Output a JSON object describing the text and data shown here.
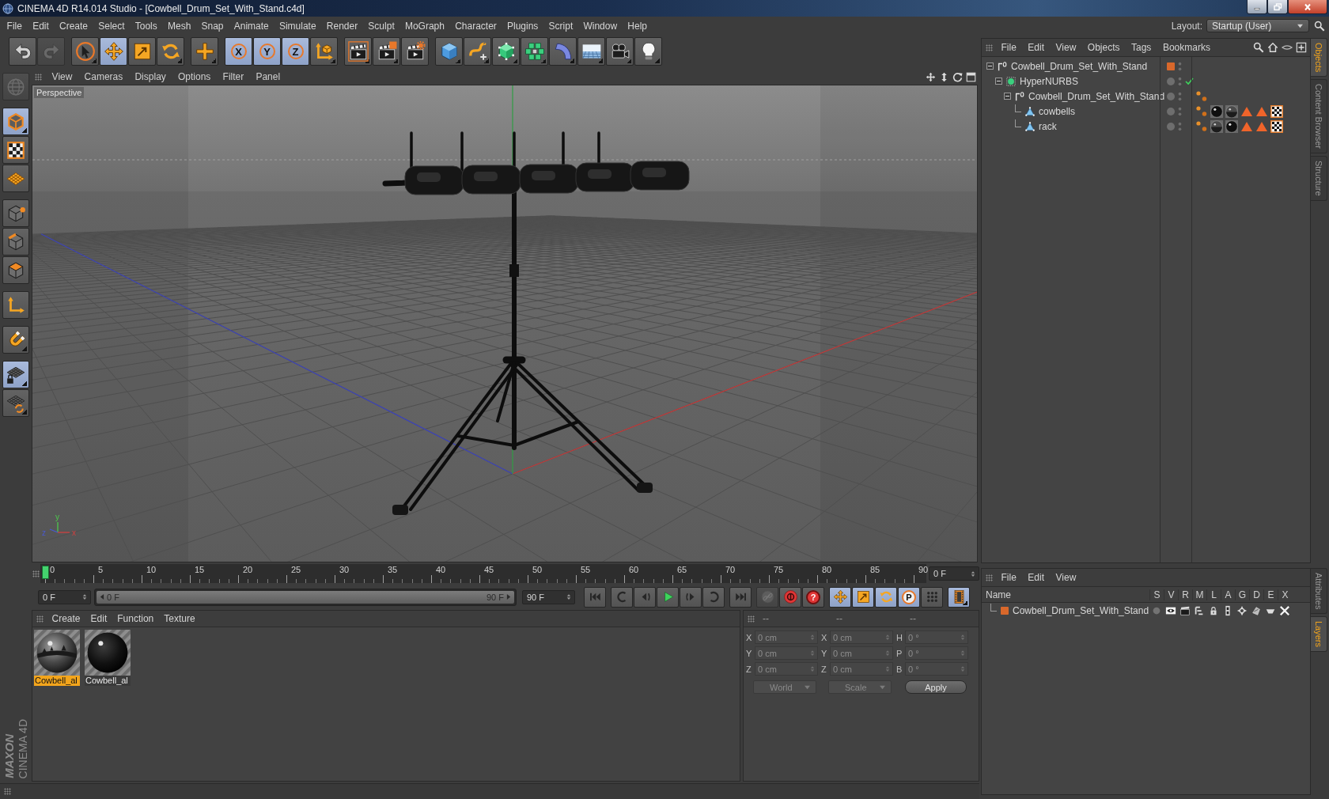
{
  "window": {
    "title": "CINEMA 4D R14.014 Studio - [Cowbell_Drum_Set_With_Stand.c4d]"
  },
  "menu_bar": [
    "File",
    "Edit",
    "Create",
    "Select",
    "Tools",
    "Mesh",
    "Snap",
    "Animate",
    "Simulate",
    "Render",
    "Sculpt",
    "MoGraph",
    "Character",
    "Plugins",
    "Script",
    "Window",
    "Help"
  ],
  "layout": {
    "label": "Layout:",
    "value": "Startup (User)"
  },
  "toolbar": [
    [
      {
        "kind": "undo",
        "selected": false,
        "disabled": false,
        "submenu": false
      },
      {
        "kind": "redo",
        "selected": false,
        "disabled": true,
        "submenu": false
      }
    ],
    [
      {
        "kind": "live-selection",
        "selected": false,
        "disabled": false,
        "submenu": true
      },
      {
        "kind": "move",
        "selected": true,
        "disabled": false,
        "submenu": false
      },
      {
        "kind": "scale",
        "selected": false,
        "disabled": false,
        "submenu": false
      },
      {
        "kind": "rotate",
        "selected": false,
        "disabled": false,
        "submenu": true
      }
    ],
    [
      {
        "kind": "last-tool",
        "selected": false,
        "disabled": false,
        "submenu": true
      }
    ],
    [
      {
        "kind": "axis",
        "label": "X",
        "selected": true,
        "disabled": false,
        "submenu": false
      },
      {
        "kind": "axis",
        "label": "Y",
        "selected": true,
        "disabled": false,
        "submenu": false
      },
      {
        "kind": "axis",
        "label": "Z",
        "selected": true,
        "disabled": false,
        "submenu": false
      },
      {
        "kind": "coordinate-system",
        "selected": false,
        "disabled": false,
        "submenu": true
      }
    ],
    [
      {
        "kind": "render-view",
        "selected": false,
        "disabled": false,
        "submenu": true
      },
      {
        "kind": "render-picture-viewer",
        "selected": false,
        "disabled": false,
        "submenu": true
      },
      {
        "kind": "render-settings",
        "selected": false,
        "disabled": false,
        "submenu": false
      }
    ],
    [
      {
        "kind": "cube",
        "selected": false,
        "disabled": false,
        "submenu": true
      },
      {
        "kind": "pen",
        "selected": false,
        "disabled": false,
        "submenu": true
      },
      {
        "kind": "subdivision",
        "selected": false,
        "disabled": false,
        "submenu": true
      },
      {
        "kind": "cloner",
        "selected": false,
        "disabled": false,
        "submenu": true
      },
      {
        "kind": "deformer",
        "selected": false,
        "disabled": false,
        "submenu": true
      },
      {
        "kind": "floor",
        "selected": false,
        "disabled": false,
        "submenu": true
      },
      {
        "kind": "camera",
        "selected": false,
        "disabled": false,
        "submenu": true
      },
      {
        "kind": "light",
        "selected": false,
        "disabled": false,
        "submenu": true
      }
    ]
  ],
  "left_toolbar": [
    [
      {
        "kind": "make-editable",
        "selected": false,
        "disabled": true,
        "submenu": false
      }
    ],
    [
      {
        "kind": "model",
        "selected": true,
        "disabled": false,
        "submenu": true
      },
      {
        "kind": "texture",
        "selected": false,
        "disabled": false,
        "submenu": false
      },
      {
        "kind": "workplane",
        "selected": false,
        "disabled": false,
        "submenu": false
      }
    ],
    [
      {
        "kind": "points",
        "selected": false,
        "disabled": false,
        "submenu": false
      },
      {
        "kind": "edges",
        "selected": false,
        "disabled": false,
        "submenu": false
      },
      {
        "kind": "polygons",
        "selected": false,
        "disabled": false,
        "submenu": false
      }
    ],
    [
      {
        "kind": "axis-mode",
        "selected": false,
        "disabled": false,
        "submenu": false
      }
    ],
    [
      {
        "kind": "snap",
        "selected": false,
        "disabled": false,
        "submenu": true
      }
    ],
    [
      {
        "kind": "locked-workplane",
        "selected": true,
        "disabled": false,
        "submenu": true
      },
      {
        "kind": "workplane-rotate",
        "selected": false,
        "disabled": false,
        "submenu": true
      }
    ]
  ],
  "viewport": {
    "menu": [
      "View",
      "Cameras",
      "Display",
      "Options",
      "Filter",
      "Panel"
    ],
    "camera": "Perspective",
    "gizmo": {
      "x": "x",
      "y": "y",
      "z": "z"
    }
  },
  "timeline": {
    "ticks": [
      "0",
      "5",
      "10",
      "15",
      "20",
      "25",
      "30",
      "35",
      "40",
      "45",
      "50",
      "55",
      "60",
      "65",
      "70",
      "75",
      "80",
      "85",
      "90"
    ],
    "level": 0,
    "current_frame": "0 F"
  },
  "transport": {
    "start": "0 F",
    "range_start": "0 F",
    "range_end": "90 F",
    "level": 1,
    "end": "90 F",
    "buttons": [
      [
        {
          "kind": "go-start",
          "selected": false,
          "disabled": false,
          "submenu": false
        }
      ],
      [
        {
          "kind": "prev-key",
          "selected": false,
          "disabled": false,
          "submenu": false
        },
        {
          "kind": "prev-frame",
          "selected": false,
          "disabled": false,
          "submenu": false
        },
        {
          "kind": "play",
          "selected": false,
          "disabled": false,
          "submenu": false
        },
        {
          "kind": "next-frame",
          "selected": false,
          "disabled": false,
          "submenu": false
        },
        {
          "kind": "next-key",
          "selected": false,
          "disabled": false,
          "submenu": false
        }
      ],
      [
        {
          "kind": "go-end",
          "selected": false,
          "disabled": false,
          "submenu": false
        }
      ],
      [
        {
          "kind": "key-link",
          "selected": false,
          "disabled": true,
          "submenu": false
        },
        {
          "kind": "record",
          "selected": false,
          "disabled": false,
          "submenu": false
        },
        {
          "kind": "autokey",
          "label": "?",
          "selected": false,
          "disabled": false,
          "submenu": false
        }
      ],
      [
        {
          "kind": "key-move",
          "selected": true,
          "disabled": false,
          "submenu": false
        },
        {
          "kind": "key-scale",
          "selected": true,
          "disabled": false,
          "submenu": false
        },
        {
          "kind": "key-rotate",
          "selected": true,
          "disabled": false,
          "submenu": false
        },
        {
          "kind": "param",
          "label": "P",
          "selected": true,
          "disabled": false,
          "submenu": false
        },
        {
          "kind": "pla",
          "selected": false,
          "disabled": false,
          "submenu": false
        }
      ],
      [
        {
          "kind": "timeline",
          "selected": true,
          "disabled": false,
          "submenu": true
        }
      ]
    ]
  },
  "material_manager": {
    "menu": [
      "Create",
      "Edit",
      "Function",
      "Texture"
    ],
    "materials": [
      {
        "name": "Cowbell_al",
        "kind": "reflective",
        "selected": true
      },
      {
        "name": "Cowbell_al",
        "kind": "glossy",
        "selected": false
      }
    ]
  },
  "coordinates": {
    "headers": [
      "--",
      "--",
      "--"
    ],
    "rows": [
      [
        {
          "axis": "X",
          "value": "0 cm"
        },
        {
          "axis": "X",
          "value": "0 cm"
        },
        {
          "axis": "H",
          "value": "0 °"
        }
      ],
      [
        {
          "axis": "Y",
          "value": "0 cm"
        },
        {
          "axis": "Y",
          "value": "0 cm"
        },
        {
          "axis": "P",
          "value": "0 °"
        }
      ],
      [
        {
          "axis": "Z",
          "value": "0 cm"
        },
        {
          "axis": "Z",
          "value": "0 cm"
        },
        {
          "axis": "B",
          "value": "0 °"
        }
      ]
    ],
    "mode": "World",
    "transform": "Scale",
    "apply": "Apply"
  },
  "object_manager": {
    "menu": [
      "File",
      "Edit",
      "View",
      "Objects",
      "Tags",
      "Bookmarks"
    ],
    "tree": [
      {
        "name": "Cowbell_Drum_Set_With_Stand",
        "kind": "null",
        "expanded": true,
        "color": "#d9682b",
        "children": [
          {
            "name": "HyperNURBS",
            "kind": "subdivision",
            "expanded": true,
            "enabled": true,
            "children": [
              {
                "name": "Cowbell_Drum_Set_With_Stand",
                "kind": "null",
                "expanded": true,
                "tags": [
                  {
                    "kind": "phong"
                  }
                ],
                "children": [
                  {
                    "name": "cowbells",
                    "kind": "polygon",
                    "tags": [
                      {
                        "kind": "phong"
                      },
                      {
                        "kind": "material-glossy"
                      },
                      {
                        "kind": "material-reflective"
                      },
                      {
                        "kind": "selection"
                      },
                      {
                        "kind": "selection"
                      },
                      {
                        "kind": "uvw"
                      }
                    ]
                  },
                  {
                    "name": "rack",
                    "kind": "polygon",
                    "tags": [
                      {
                        "kind": "phong"
                      },
                      {
                        "kind": "material-reflective"
                      },
                      {
                        "kind": "material-glossy"
                      },
                      {
                        "kind": "selection"
                      },
                      {
                        "kind": "selection"
                      },
                      {
                        "kind": "uvw"
                      }
                    ]
                  }
                ]
              }
            ]
          }
        ]
      }
    ]
  },
  "layer_manager": {
    "menu": [
      "File",
      "Edit",
      "View"
    ],
    "columns": [
      "Name",
      "S",
      "V",
      "R",
      "M",
      "L",
      "A",
      "G",
      "D",
      "E",
      "X"
    ],
    "layers": [
      {
        "name": "Cowbell_Drum_Set_With_Stand",
        "color": "#d9682b",
        "flags": [
          {
            "kind": "solo",
            "on": false
          },
          {
            "kind": "visible",
            "on": true
          },
          {
            "kind": "render",
            "on": true
          },
          {
            "kind": "manager",
            "on": true
          },
          {
            "kind": "locked",
            "on": true
          },
          {
            "kind": "animation",
            "on": true
          },
          {
            "kind": "generators",
            "on": true
          },
          {
            "kind": "deformers",
            "on": true
          },
          {
            "kind": "expressions",
            "on": true
          },
          {
            "kind": "xref",
            "on": true
          }
        ]
      }
    ]
  },
  "side_tabs": {
    "top": [
      {
        "label": "Objects",
        "selected": true
      },
      {
        "label": "Content Browser",
        "selected": false
      },
      {
        "label": "Structure",
        "selected": false
      }
    ],
    "bottom": [
      {
        "label": "Attributes",
        "selected": false
      },
      {
        "label": "Layers",
        "selected": true
      }
    ]
  },
  "logo": {
    "brand": "MAXON",
    "product": "CINEMA 4D"
  }
}
